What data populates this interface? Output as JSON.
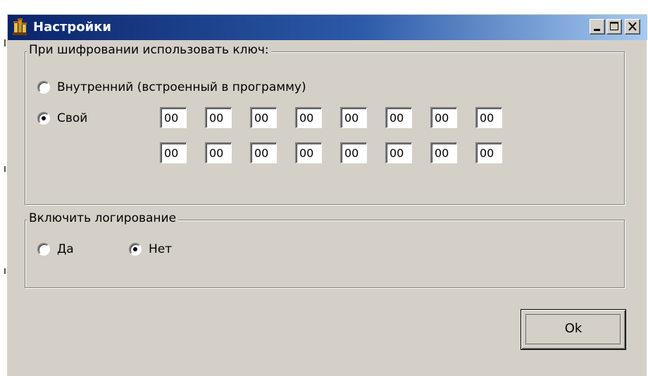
{
  "window": {
    "title": "Настройки",
    "icon": "app-chess-icon",
    "controls": [
      "minimize-icon",
      "maximize-icon",
      "close-icon"
    ]
  },
  "encryption": {
    "legend": "При шифровании использовать ключ:",
    "option_internal": "Внутренний (встроенный в программу)",
    "option_own": "Свой",
    "selected": "own",
    "key_bytes": [
      [
        "00",
        "00",
        "00",
        "00",
        "00",
        "00",
        "00",
        "00"
      ],
      [
        "00",
        "00",
        "00",
        "00",
        "00",
        "00",
        "00",
        "00"
      ]
    ]
  },
  "logging": {
    "legend": "Включить логирование",
    "option_yes": "Да",
    "option_no": "Нет",
    "selected": "no"
  },
  "ok_label": "Ok"
}
